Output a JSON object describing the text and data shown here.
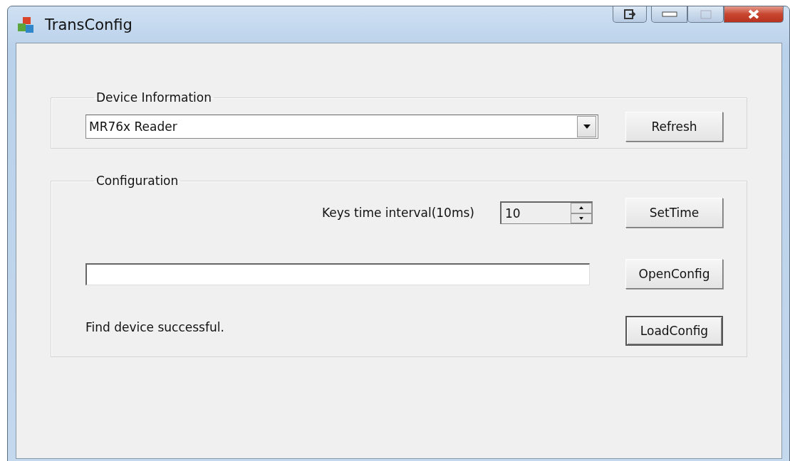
{
  "window": {
    "title": "TransConfig"
  },
  "device_information": {
    "title": "Device Information",
    "device_select": {
      "value": "MR76x Reader"
    },
    "refresh_button": {
      "label": "Refresh",
      "default": false
    }
  },
  "configuration": {
    "title": "Configuration",
    "interval_label": "Keys time interval(10ms)",
    "interval_spinner": {
      "value": "10"
    },
    "set_time_button": {
      "label": "SetTime",
      "default": false
    },
    "open_config_button": {
      "label": "OpenConfig",
      "default": false
    },
    "status": "Find device successful.",
    "load_config_button": {
      "label": "LoadConfig",
      "default": true
    }
  }
}
